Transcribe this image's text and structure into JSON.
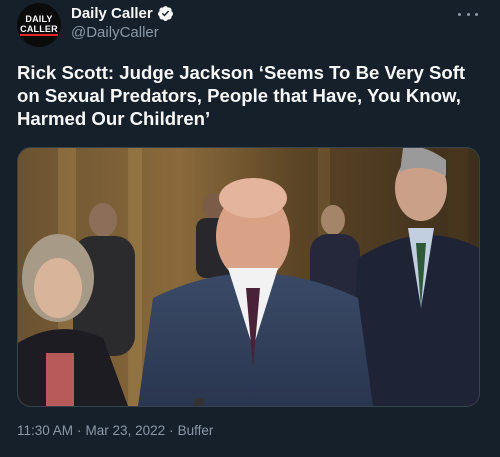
{
  "account": {
    "name": "Daily Caller",
    "handle": "@DailyCaller",
    "avatar_line1": "DAILY",
    "avatar_line2": "CALLER"
  },
  "tweet": {
    "text": "Rick Scott: Judge Jackson ‘Seems To Be Very Soft on Sexual Predators, People that Have, You Know, Harmed Our Children’",
    "time": "11:30 AM",
    "separator1": "·",
    "date": "Mar 23, 2022",
    "separator2": "·",
    "source": "Buffer"
  },
  "icons": {
    "verified": "verified-badge-icon",
    "more": "more-options-icon"
  },
  "colors": {
    "background": "#15202b",
    "text_primary": "#f7f9f9",
    "text_secondary": "#8b98a5",
    "verified": "#f7f9f9"
  }
}
